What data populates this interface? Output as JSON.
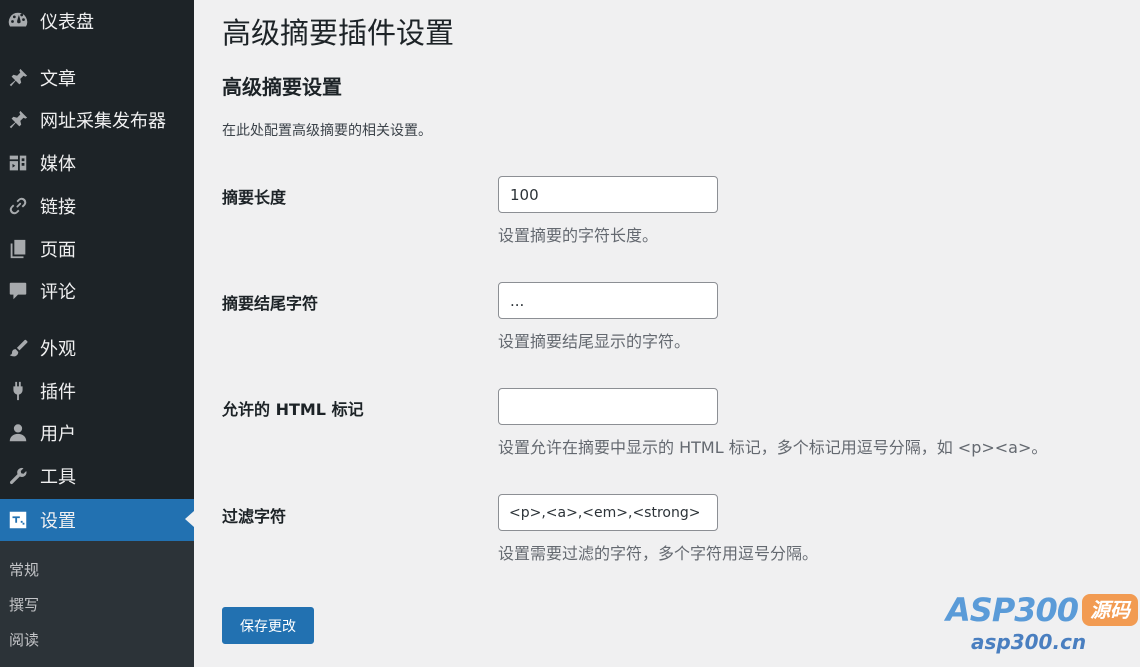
{
  "sidebar": {
    "items": [
      {
        "label": "仪表盘",
        "icon": "dashboard-icon"
      },
      {
        "label": "文章",
        "icon": "pin-icon"
      },
      {
        "label": "网址采集发布器",
        "icon": "pin-icon"
      },
      {
        "label": "媒体",
        "icon": "media-icon"
      },
      {
        "label": "链接",
        "icon": "link-icon"
      },
      {
        "label": "页面",
        "icon": "page-icon"
      },
      {
        "label": "评论",
        "icon": "comment-icon"
      },
      {
        "label": "外观",
        "icon": "brush-icon"
      },
      {
        "label": "插件",
        "icon": "plugin-icon"
      },
      {
        "label": "用户",
        "icon": "user-icon"
      },
      {
        "label": "工具",
        "icon": "wrench-icon"
      },
      {
        "label": "设置",
        "icon": "settings-icon",
        "active": true
      }
    ],
    "submenu": [
      "常规",
      "撰写",
      "阅读"
    ]
  },
  "main": {
    "page_title": "高级摘要插件设置",
    "section_title": "高级摘要设置",
    "section_desc": "在此处配置高级摘要的相关设置。",
    "fields": [
      {
        "label": "摘要长度",
        "value": "100",
        "help": "设置摘要的字符长度。"
      },
      {
        "label": "摘要结尾字符",
        "value": "...",
        "help": "设置摘要结尾显示的字符。"
      },
      {
        "label": "允许的 HTML 标记",
        "value": "",
        "help": "设置允许在摘要中显示的 HTML 标记，多个标记用逗号分隔，如 <p><a>。"
      },
      {
        "label": "过滤字符",
        "value": "<p>,<a>,<em>,<strong>",
        "help": "设置需要过滤的字符，多个字符用逗号分隔。"
      }
    ],
    "save_label": "保存更改"
  },
  "watermark": {
    "brand": "ASP300",
    "badge": "源码",
    "url": "asp300.cn"
  },
  "colors": {
    "sidebar_bg": "#1d2327",
    "submenu_bg": "#2c3338",
    "accent": "#2271b1",
    "page_bg": "#f0f0f1"
  }
}
